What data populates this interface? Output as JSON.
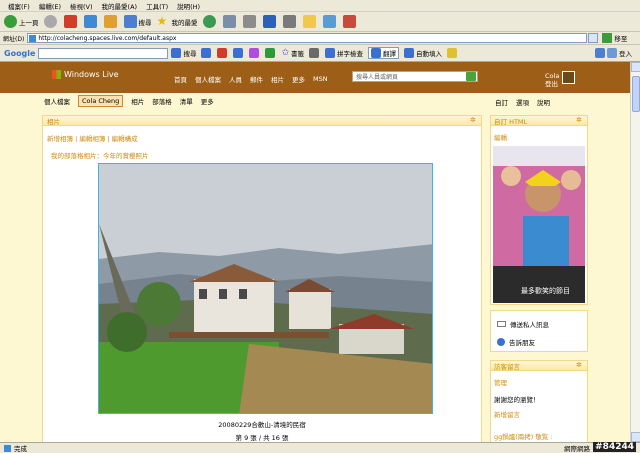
{
  "menubar": [
    "檔案(F)",
    "編輯(E)",
    "檢視(V)",
    "我的最愛(A)",
    "工具(T)",
    "說明(H)"
  ],
  "toolbar": {
    "back": "上一頁",
    "search": "搜尋",
    "favorites": "我的最愛"
  },
  "addressbar": {
    "label": "網址(D)",
    "url": "http://colacheng.spaces.live.com/default.aspx",
    "go": "移至"
  },
  "googlebar": {
    "brand": "Google",
    "search": "搜尋",
    "bookmarks": "書籤",
    "spellcheck": "拼字檢查",
    "translate": "翻譯",
    "autofill": "自動填入",
    "signin": "登入"
  },
  "live": {
    "logo": "Windows Live",
    "nav": [
      "首頁",
      "個人檔案",
      "人員",
      "郵件",
      "相片",
      "更多",
      "MSN"
    ],
    "search_placeholder": "搜尋人員或網頁",
    "username": "Cola",
    "signout": "登出"
  },
  "subnav": {
    "items": [
      "個人檔案",
      "Cola Cheng",
      "相片",
      "部落格",
      "清單",
      "更多"
    ],
    "right": [
      "自訂",
      "選項",
      "說明"
    ]
  },
  "main": {
    "title": "相片",
    "links": "新增相簿 | 編輯相簿 | 編輯構成",
    "album": "我的部落格相片：今年的賞櫻照片",
    "caption": "20080229合歡山-清境的民宿",
    "count": "第 9 張 / 共 16 張"
  },
  "right": {
    "p1_title": "自訂 HTML",
    "p1_edit": "編輯",
    "p1_img_text": "最多歡笑的節目",
    "p2_items": [
      "傳送私人訊息",
      "告訴朋友"
    ],
    "p3_title": "訪客留言",
    "p3_admin": "管理",
    "p3_thanks": "謝謝您的瀏覽！",
    "p3_new": "新增留言",
    "p3_entry": "gg鍋爐(兩拷) 敬覧 :"
  },
  "statusbar": {
    "status": "完成",
    "zone": "網際網路"
  },
  "watermark": "#84244"
}
